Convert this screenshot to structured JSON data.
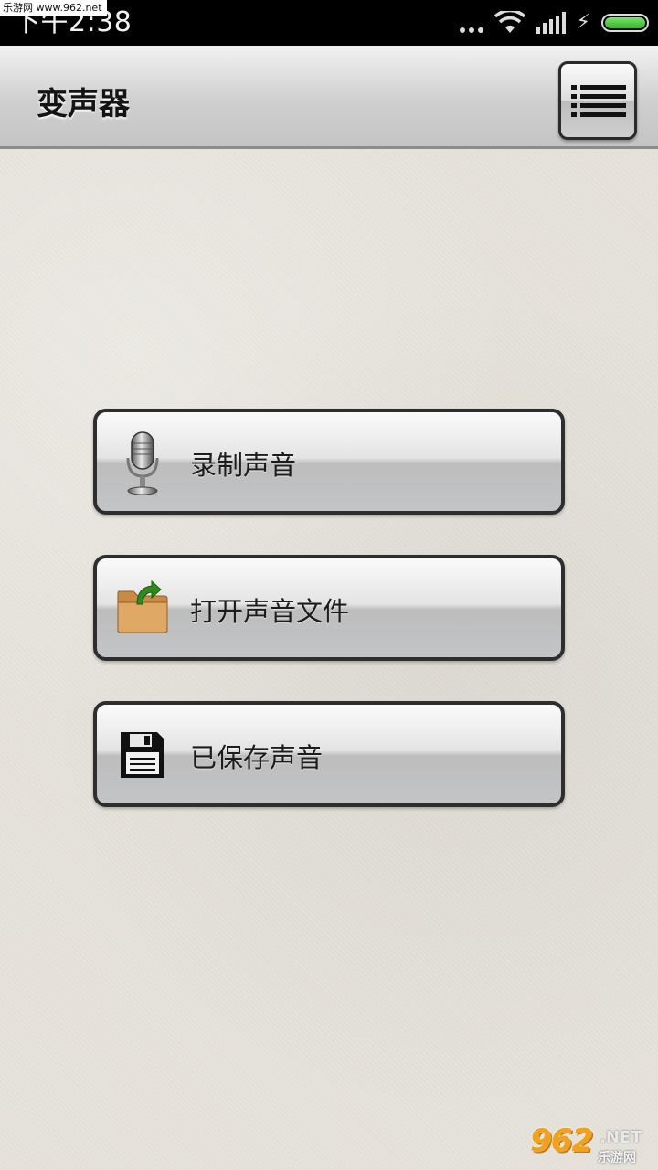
{
  "status_bar": {
    "time": "下午2:38",
    "watermark": "乐游网 www.962.net"
  },
  "header": {
    "title": "变声器",
    "menu_icon": "list-menu-icon"
  },
  "actions": [
    {
      "label": "录制声音",
      "icon": "microphone-icon"
    },
    {
      "label": "打开声音文件",
      "icon": "folder-open-icon"
    },
    {
      "label": "已保存声音",
      "icon": "floppy-disk-icon"
    }
  ],
  "watermark_bottom": {
    "logo": "962",
    "domain": ".NET",
    "name": "乐游网"
  },
  "colors": {
    "background": "#e5e2da",
    "folder": "#d79b55",
    "arrow": "#2e8a1c",
    "battery": "#3fc43a"
  }
}
